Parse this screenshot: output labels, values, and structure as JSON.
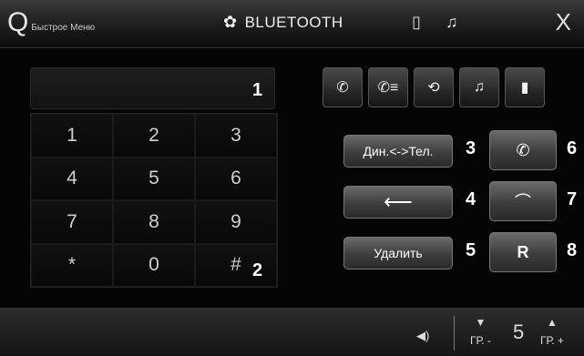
{
  "header": {
    "quick_menu_icon": "Q",
    "quick_menu_label": "Быстрое Меню",
    "title": "BLUETOOTH",
    "title_icon": "gear-icon",
    "phone_icon_glyph": "▯",
    "music_icon_glyph": "♫",
    "close_glyph": "X"
  },
  "display": {
    "value": ""
  },
  "keypad": {
    "keys": [
      "1",
      "2",
      "3",
      "4",
      "5",
      "6",
      "7",
      "8",
      "9",
      "*",
      "0",
      "#"
    ]
  },
  "modes": [
    {
      "name": "call-mode",
      "glyph": "✆"
    },
    {
      "name": "call-list-mode",
      "glyph": "✆≡"
    },
    {
      "name": "sync-mode",
      "glyph": "⟲"
    },
    {
      "name": "music-mode",
      "glyph": "♫"
    },
    {
      "name": "phonebook-mode",
      "glyph": "▮"
    }
  ],
  "buttons": {
    "speaker_toggle": "Дин.<->Тел.",
    "backspace": "⟵",
    "delete": "Удалить",
    "call": "✆",
    "hangup": "⌒",
    "redial": "R"
  },
  "callouts": {
    "c1": "1",
    "c2": "2",
    "c3": "3",
    "c4": "4",
    "c5": "5",
    "c6": "6",
    "c7": "7",
    "c8": "8"
  },
  "footer": {
    "volume_glyph": "◀)",
    "group_down_arrow": "▼",
    "group_down_label": "ГР. -",
    "group_number": "5",
    "group_up_arrow": "▲",
    "group_up_label": "ГР. +"
  }
}
